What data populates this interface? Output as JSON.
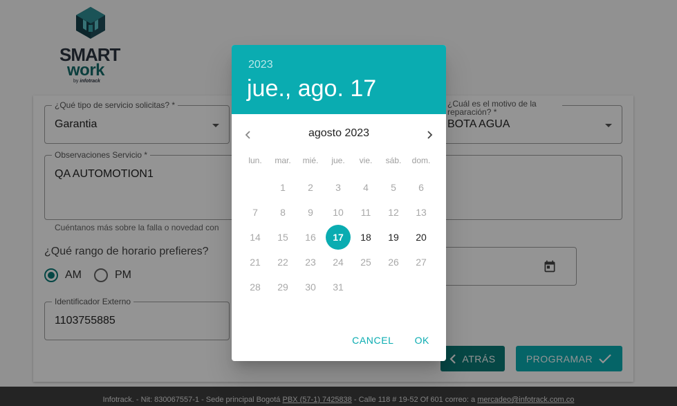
{
  "logo": {
    "line1": "SMART",
    "line2": "work",
    "by": "by",
    "brand": "infotrack"
  },
  "form": {
    "service_type": {
      "label": "¿Qué tipo de servicio solicitas? *",
      "value": "Garantia"
    },
    "middle_field": {
      "value": ""
    },
    "motive": {
      "label": "¿Cuál es el motivo de la reparación? *",
      "value": "BOTA AGUA"
    },
    "observations": {
      "label": "Observaciones Servicio *",
      "value": "QA AUTOMOTION1",
      "helper": "Cuéntanos más sobre la falla o novedad con"
    },
    "schedule": {
      "question": "¿Qué rango de horario prefieres?",
      "options": [
        "AM",
        "PM"
      ],
      "selected": "AM"
    },
    "external_id": {
      "label": "Identificador Externo",
      "value": "1103755885"
    },
    "back_button": "ATRÁS",
    "schedule_button": "PROGRAMAR"
  },
  "footer": {
    "prefix": "Infotrack. - Nit: 830067557-1 - Sede principal Bogotá",
    "phone": "PBX (57-1) 7425838",
    "address": "- Calle 118 # 19-52 Of 601   correo: a",
    "email": "mercadeo@infotrack.com.co"
  },
  "datepicker": {
    "year": "2023",
    "date_display": "jue., ago. 17",
    "month_label": "agosto 2023",
    "weekdays": [
      "lun.",
      "mar.",
      "mié.",
      "jue.",
      "vie.",
      "sáb.",
      "dom."
    ],
    "weeks": [
      [
        "",
        "1",
        "2",
        "3",
        "4",
        "5",
        "6"
      ],
      [
        "7",
        "8",
        "9",
        "10",
        "11",
        "12",
        "13"
      ],
      [
        "14",
        "15",
        "16",
        "17",
        "18",
        "19",
        "20"
      ],
      [
        "21",
        "22",
        "23",
        "24",
        "25",
        "26",
        "27"
      ],
      [
        "28",
        "29",
        "30",
        "31",
        "",
        "",
        ""
      ]
    ],
    "selected_day": "17",
    "enabled_days": [
      "17",
      "18",
      "19",
      "20"
    ],
    "cancel_label": "CANCEL",
    "ok_label": "OK"
  },
  "colors": {
    "accent": "#0aacb1",
    "dark_teal": "#0c7a78",
    "footer": "#3f3f3f"
  }
}
